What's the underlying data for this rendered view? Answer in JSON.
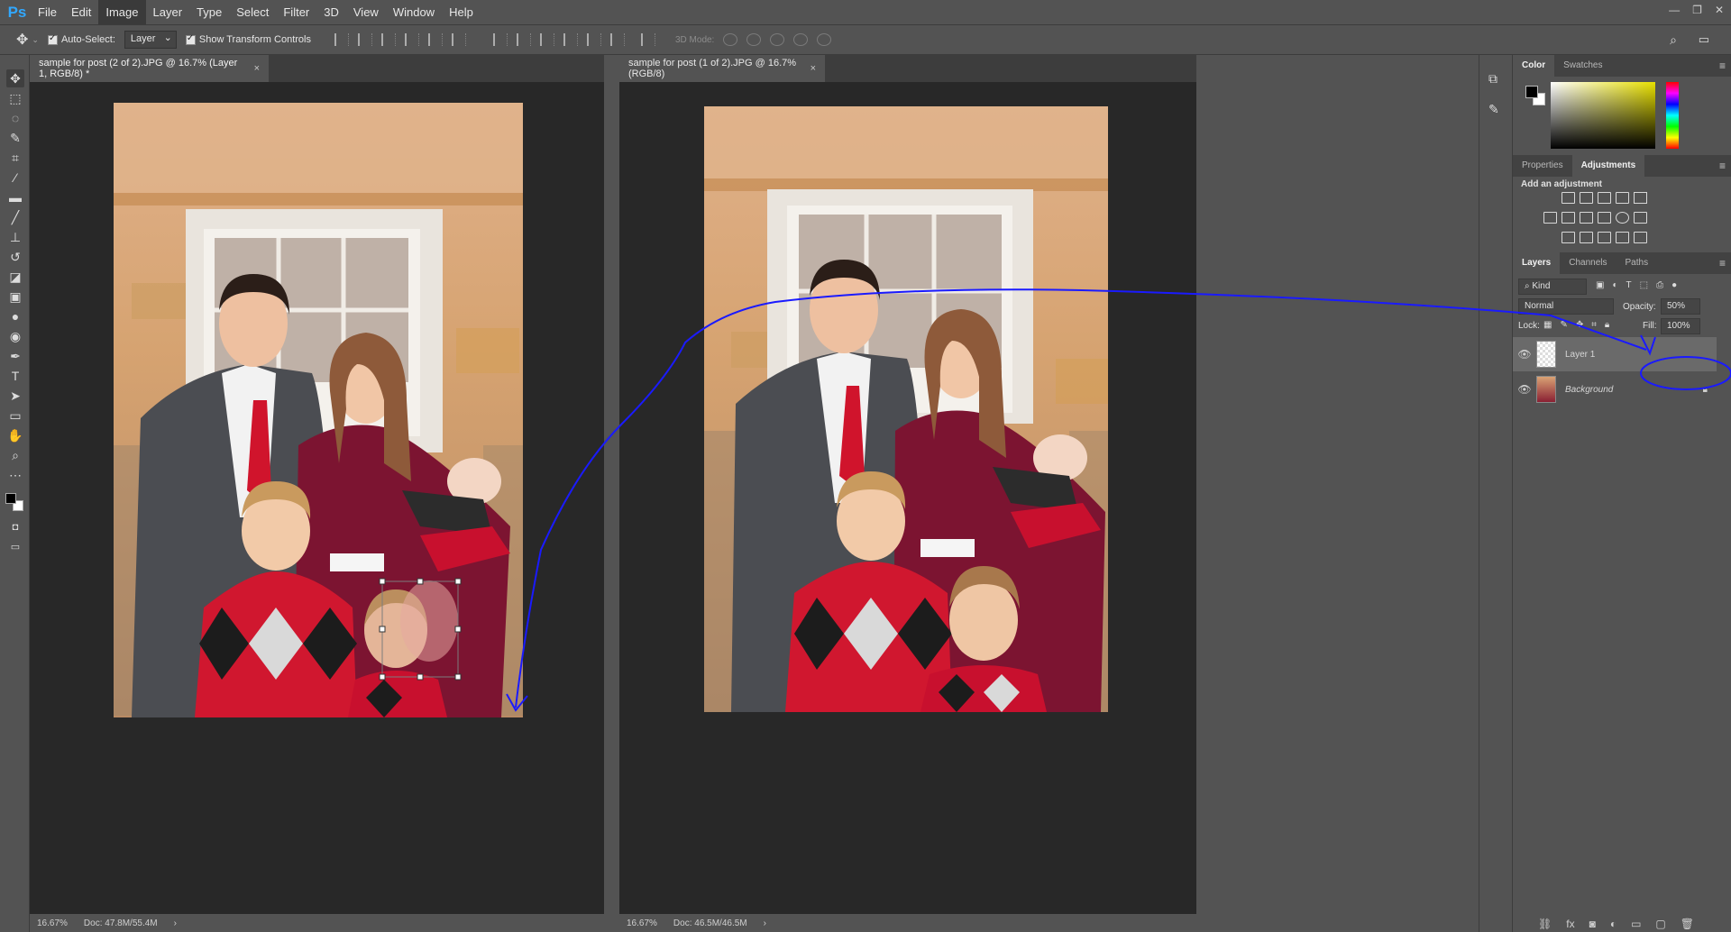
{
  "app": {
    "logo": "Ps"
  },
  "menu": [
    "File",
    "Edit",
    "Image",
    "Layer",
    "Type",
    "Select",
    "Filter",
    "3D",
    "View",
    "Window",
    "Help"
  ],
  "menu_active": "Image",
  "window_controls": [
    "—",
    "❐",
    "✕"
  ],
  "options": {
    "auto_select_label": "Auto-Select:",
    "auto_select_value": "Layer",
    "show_transform_label": "Show Transform Controls",
    "mode_3d_label": "3D Mode:"
  },
  "docs": [
    {
      "tab": "sample for post (2 of 2).JPG @ 16.7% (Layer 1, RGB/8) *",
      "zoom": "16.67%",
      "doc_info": "Doc: 47.8M/55.4M"
    },
    {
      "tab": "sample for post (1 of 2).JPG @ 16.7% (RGB/8)",
      "zoom": "16.67%",
      "doc_info": "Doc: 46.5M/46.5M"
    }
  ],
  "panels": {
    "color_tabs": [
      "Color",
      "Swatches"
    ],
    "adj_tabs": [
      "Properties",
      "Adjustments"
    ],
    "add_adjustment": "Add an adjustment",
    "layers_tabs": [
      "Layers",
      "Channels",
      "Paths"
    ],
    "kind": "Kind",
    "blend_mode": "Normal",
    "opacity_label": "Opacity:",
    "opacity_value": "50%",
    "lock_label": "Lock:",
    "fill_label": "Fill:",
    "fill_value": "100%",
    "layers": [
      {
        "name": "Layer 1",
        "selected": true
      },
      {
        "name": "Background",
        "selected": false,
        "locked": true
      }
    ]
  },
  "colors": {
    "annotation": "#1a1aff",
    "foreground": "#000000",
    "background": "#ffffff"
  }
}
